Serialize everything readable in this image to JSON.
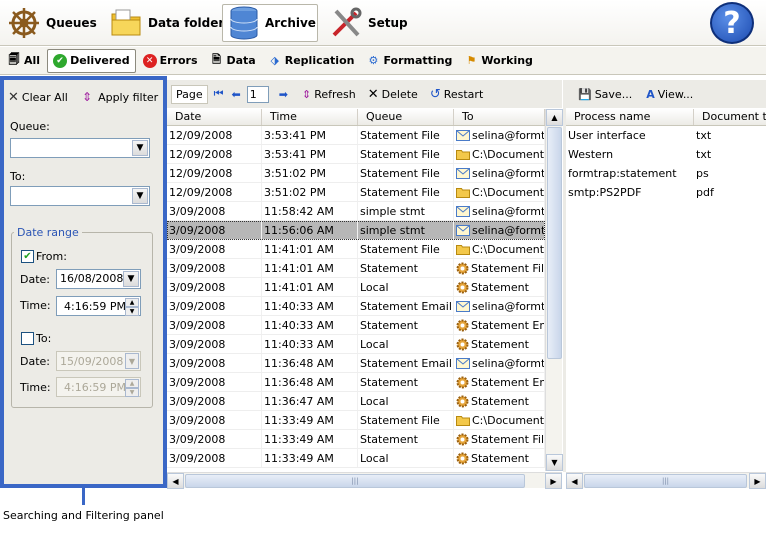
{
  "nav": {
    "items": [
      {
        "label": "Queues",
        "icon": "ship-wheel-icon"
      },
      {
        "label": "Data folders",
        "icon": "folders-icon"
      },
      {
        "label": "Archive",
        "icon": "database-icon",
        "active": true
      },
      {
        "label": "Setup",
        "icon": "tools-icon"
      }
    ],
    "help_glyph": "?"
  },
  "subtabs": [
    {
      "label": "All",
      "icon": "documents-icon"
    },
    {
      "label": "Delivered",
      "icon": "check-icon",
      "active": true
    },
    {
      "label": "Errors",
      "icon": "error-icon"
    },
    {
      "label": "Data",
      "icon": "data-icon"
    },
    {
      "label": "Replication",
      "icon": "replication-icon"
    },
    {
      "label": "Formatting",
      "icon": "formatting-icon"
    },
    {
      "label": "Working",
      "icon": "flag-icon"
    }
  ],
  "filter": {
    "clear_label": "Clear All",
    "apply_label": "Apply filter",
    "queue_label": "Queue:",
    "to_label": "To:",
    "date_range_label": "Date range",
    "from_label": "From:",
    "from_checked": true,
    "from_date_label": "Date:",
    "from_date": "16/08/2008",
    "from_time_label": "Time:",
    "from_time": "4:16:59 PM",
    "to_check_label": "To:",
    "to_checked": false,
    "to_date_label": "Date:",
    "to_date": "15/09/2008",
    "to_time_label": "Time:",
    "to_time": "4:16:59 PM"
  },
  "callout": "Searching and Filtering panel",
  "toolbar": {
    "page_label": "Page",
    "page_value": "1",
    "refresh_label": "Refresh",
    "delete_label": "Delete",
    "restart_label": "Restart"
  },
  "table": {
    "columns": [
      "Date",
      "Time",
      "Queue",
      "To"
    ],
    "rows": [
      {
        "date": "12/09/2008",
        "time": "3:53:41 PM",
        "queue": "Statement File",
        "to": "selina@formtr.",
        "icon": "email-icon"
      },
      {
        "date": "12/09/2008",
        "time": "3:53:41 PM",
        "queue": "Statement File",
        "to": "C:\\Document...",
        "icon": "folder-icon"
      },
      {
        "date": "12/09/2008",
        "time": "3:51:02 PM",
        "queue": "Statement File",
        "to": "selina@formtr.",
        "icon": "email-icon"
      },
      {
        "date": "12/09/2008",
        "time": "3:51:02 PM",
        "queue": "Statement File",
        "to": "C:\\Document...",
        "icon": "folder-icon"
      },
      {
        "date": "3/09/2008",
        "time": "11:58:42 AM",
        "queue": "simple stmt",
        "to": "selina@formtr.",
        "icon": "email-icon"
      },
      {
        "date": "3/09/2008",
        "time": "11:56:06 AM",
        "queue": "simple stmt",
        "to": "selina@formtr.",
        "icon": "email-icon",
        "selected": true
      },
      {
        "date": "3/09/2008",
        "time": "11:41:01 AM",
        "queue": "Statement File",
        "to": "C:\\Document...",
        "icon": "folder-icon"
      },
      {
        "date": "3/09/2008",
        "time": "11:41:01 AM",
        "queue": "Statement",
        "to": "Statement File",
        "icon": "gear-icon"
      },
      {
        "date": "3/09/2008",
        "time": "11:41:01 AM",
        "queue": "Local",
        "to": "Statement",
        "icon": "gear-icon"
      },
      {
        "date": "3/09/2008",
        "time": "11:40:33 AM",
        "queue": "Statement Email",
        "to": "selina@formtr.",
        "icon": "email-icon"
      },
      {
        "date": "3/09/2008",
        "time": "11:40:33 AM",
        "queue": "Statement",
        "to": "Statement Ema",
        "icon": "gear-icon"
      },
      {
        "date": "3/09/2008",
        "time": "11:40:33 AM",
        "queue": "Local",
        "to": "Statement",
        "icon": "gear-icon"
      },
      {
        "date": "3/09/2008",
        "time": "11:36:48 AM",
        "queue": "Statement Email",
        "to": "selina@formtr.",
        "icon": "email-icon"
      },
      {
        "date": "3/09/2008",
        "time": "11:36:48 AM",
        "queue": "Statement",
        "to": "Statement Ema",
        "icon": "gear-icon"
      },
      {
        "date": "3/09/2008",
        "time": "11:36:47 AM",
        "queue": "Local",
        "to": "Statement",
        "icon": "gear-icon"
      },
      {
        "date": "3/09/2008",
        "time": "11:33:49 AM",
        "queue": "Statement File",
        "to": "C:\\Document...",
        "icon": "folder-icon"
      },
      {
        "date": "3/09/2008",
        "time": "11:33:49 AM",
        "queue": "Statement",
        "to": "Statement File",
        "icon": "gear-icon"
      },
      {
        "date": "3/09/2008",
        "time": "11:33:49 AM",
        "queue": "Local",
        "to": "Statement",
        "icon": "gear-icon"
      }
    ]
  },
  "right": {
    "save_label": "Save...",
    "view_label": "View...",
    "columns": [
      "Process name",
      "Document ty"
    ],
    "rows": [
      {
        "process": "User interface",
        "doc": "txt"
      },
      {
        "process": "Western",
        "doc": "txt"
      },
      {
        "process": "formtrap:statement",
        "doc": "ps"
      },
      {
        "process": "smtp:PS2PDF",
        "doc": "pdf"
      }
    ]
  },
  "colors": {
    "panel_border": "#3a67c6",
    "selected_row": "#b7b7b7"
  }
}
